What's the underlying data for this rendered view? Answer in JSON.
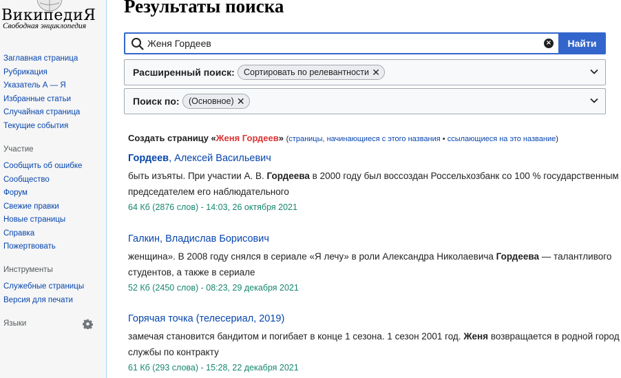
{
  "logo": {
    "wordmark": "ВикипедиЯ",
    "tagline": "Свободная энциклопедия"
  },
  "sidebar": {
    "main_links": [
      "Заглавная страница",
      "Рубрикация",
      "Указатель А — Я",
      "Избранные статьи",
      "Случайная страница",
      "Текущие события"
    ],
    "participation_heading": "Участие",
    "participation_links": [
      "Сообщить об ошибке",
      "Сообщество",
      "Форум",
      "Свежие правки",
      "Новые страницы",
      "Справка",
      "Пожертвовать"
    ],
    "tools_heading": "Инструменты",
    "tools_links": [
      "Служебные страницы",
      "Версия для печати"
    ],
    "languages_heading": "Языки"
  },
  "page": {
    "title": "Результаты поиска"
  },
  "search": {
    "value": "Женя Гордеев",
    "button_label": "Найти"
  },
  "advanced": {
    "label": "Расширенный поиск:",
    "chip": "Сортировать по релевантности"
  },
  "namespace": {
    "label": "Поиск по:",
    "chip": "(Основное)"
  },
  "create": {
    "prefix": "Создать страницу «",
    "title": "Женя Гордеев",
    "suffix": "»",
    "open_paren": "(",
    "link1": "страницы, начинающиеся с этого названия",
    "sep": " • ",
    "link2": "ссылающиеся на это название",
    "close_paren": ")"
  },
  "results": [
    {
      "title_bold": "Гордеев",
      "title_rest": ", Алексей Васильевич",
      "line1_a": "быть изъяты. При участии А. В. ",
      "line1_b": "Гордеева",
      "line1_c": " в 2000 году был воссоздан Россельхозбанк со 100 % государственным",
      "line2": "председателем его наблюдательного",
      "meta": "64 Кб (2876 слов) - 14:03, 26 октября 2021"
    },
    {
      "title": "Галкин, Владислав Борисович",
      "line1_a": "женщина». В 2008 году снялся в сериале «Я лечу» в роли Александра Николаевича ",
      "line1_b": "Гордеева",
      "line1_c": " — талантливого",
      "line2": "студентов, а также в сериале",
      "meta": "52 Кб (2450 слов) - 08:23, 29 декабря 2021"
    },
    {
      "title": "Горячая точка (телесериал, 2019)",
      "line1_a": "замечая становится бандитом и погибает в конце 1 сезона. 1 сезон 2001 год. ",
      "line1_b": "Женя",
      "line1_c": " возвращается в родной город",
      "line2": "службы по контракту",
      "meta": "61 Кб (293 слова) - 15:28, 22 декабря 2021"
    }
  ]
}
